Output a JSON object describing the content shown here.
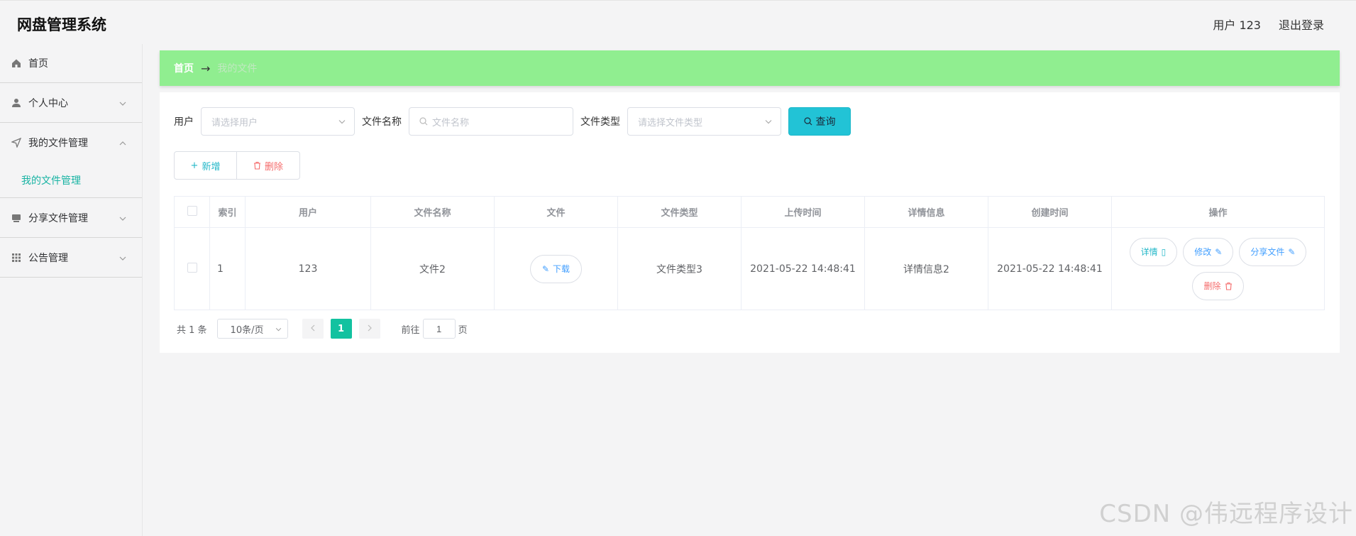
{
  "app": {
    "title": "网盘管理系统",
    "user": "用户 123",
    "logout": "退出登录"
  },
  "sidebar": {
    "items": [
      {
        "label": "首页",
        "icon": "home-icon"
      },
      {
        "label": "个人中心",
        "icon": "user-icon"
      },
      {
        "label": "我的文件管理",
        "icon": "send-icon",
        "sub": "我的文件管理"
      },
      {
        "label": "分享文件管理",
        "icon": "folder-icon"
      },
      {
        "label": "公告管理",
        "icon": "grid-icon"
      }
    ]
  },
  "breadcrumb": {
    "home": "首页",
    "current": "我的文件"
  },
  "filters": {
    "user_label": "用户",
    "user_placeholder": "请选择用户",
    "name_label": "文件名称",
    "name_placeholder": "文件名称",
    "type_label": "文件类型",
    "type_placeholder": "请选择文件类型",
    "query": "查询"
  },
  "actions": {
    "add": "新增",
    "delete": "删除"
  },
  "table": {
    "headers": [
      "索引",
      "用户",
      "文件名称",
      "文件",
      "文件类型",
      "上传时间",
      "详情信息",
      "创建时间",
      "操作"
    ],
    "rows": [
      {
        "index": "1",
        "user": "123",
        "file_name": "文件2",
        "file_btn": "下载",
        "file_type": "文件类型3",
        "upload_time": "2021-05-22 14:48:41",
        "details": "详情信息2",
        "create_time": "2021-05-22 14:48:41",
        "ops": {
          "detail": "详情",
          "edit": "修改",
          "share": "分享文件",
          "delete": "删除"
        }
      }
    ]
  },
  "pagination": {
    "total": "共 1 条",
    "size": "10条/页",
    "current": "1",
    "goto_prefix": "前往",
    "goto_value": "1",
    "goto_suffix": "页"
  },
  "watermark": "CSDN @伟远程序设计",
  "colors": {
    "accent": "#13c2a0",
    "breadcrumb_bg": "#90ee90",
    "query_btn": "#22c3d6",
    "danger": "#f56c6c"
  }
}
